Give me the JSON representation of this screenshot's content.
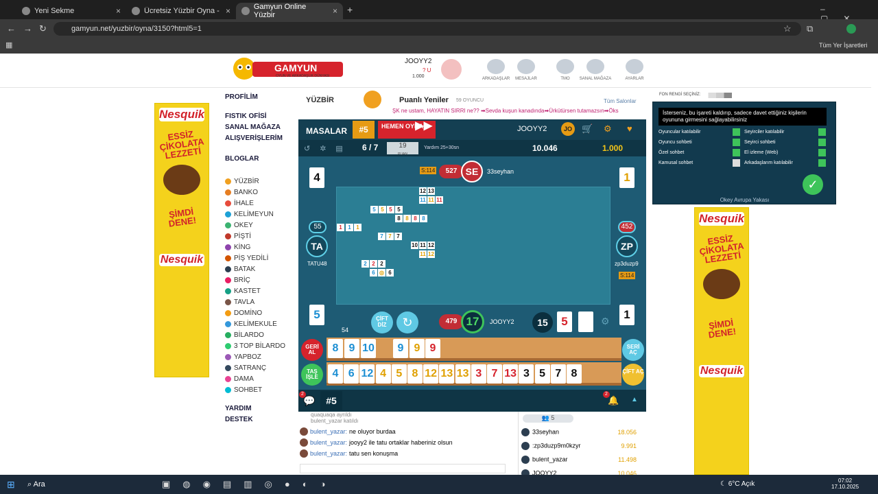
{
  "browser": {
    "tabs": [
      "Yeni Sekme",
      "Ücretsiz Yüzbir Oyna - Salon Li",
      "Gamyun Online Yüzbir"
    ],
    "url": "gamyun.net/yuzbir/oyna/3150?html5=1",
    "bookmarks_label": "Tüm Yer İşaretleri"
  },
  "site": {
    "logo": "GAMYUN",
    "logo_sub": "OYUN VE ARKADAŞLIK DÜNYASI",
    "user": "JOOYY2",
    "user_stat1": "? U",
    "user_stat2": "1.000",
    "nav": [
      "ARKADAŞLAR",
      "MESAJLAR",
      "TMO",
      "SANAL MAĞAZA",
      "AYARLAR"
    ]
  },
  "menu": {
    "items": [
      "PROFİLİM",
      "FISTIK OFİSİ",
      "SANAL MAĞAZA",
      "ALIŞVERİŞLERİM",
      "BLOGLAR"
    ],
    "games": [
      "YÜZBİR",
      "BANKO",
      "İHALE",
      "KELİMEYUN",
      "OKEY",
      "PİŞTİ",
      "KİNG",
      "PİŞ YEDİLİ",
      "BATAK",
      "BRİÇ",
      "KASTET",
      "TAVLA",
      "DOMİNO",
      "KELİMEKULE",
      "BİLARDO",
      "3 TOP BİLARDO",
      "YAPBOZ",
      "SATRANÇ",
      "DAMA",
      "SOHBET"
    ],
    "bottom": [
      "YARDIM",
      "DESTEK"
    ]
  },
  "room": {
    "game": "YÜZBİR",
    "category": "Puanlı Yeniler",
    "players": "59 OYUNCU",
    "all_rooms": "Tüm Salonlar",
    "ticker": "ŞK ne ustam, HAYATIN SIRRI ne?? ➡Sevda kuşun kanadında➡Ürkütürsen tutamazsın➡Öks"
  },
  "game": {
    "masalar": "MASALAR",
    "table_no": "#5",
    "play_now": "HEMEN OYNA!",
    "player_name": "JOOYY2",
    "player_badge": "JO",
    "round": "6 / 7",
    "points": "19",
    "points_label": "PUAN",
    "help": "Yardım 25+30sn",
    "chips": "10.046",
    "gold": "1.000",
    "top": {
      "score": "527",
      "badge": "SE",
      "name": "33seyhan",
      "s": "S:114",
      "card": "4",
      "card_r": "1"
    },
    "left": {
      "score": "55",
      "badge": "TA",
      "name": "TATU48",
      "card": "5"
    },
    "right": {
      "score": "452",
      "badge": "ZP",
      "name": "zp3duzp9",
      "s": "S:114",
      "card": "1"
    },
    "me": {
      "score": "479",
      "num": "17",
      "name": "JOOYY2",
      "cift": "ÇİFT DİZ",
      "count": "54",
      "deck": "15",
      "open": "5"
    },
    "btns": {
      "geri": "GERİ AL",
      "tas": "TAŞ İŞLE",
      "seri": "SERİ AÇ",
      "cift": "ÇİFT AÇ"
    },
    "rack1": [
      {
        "v": "8",
        "c": "bl"
      },
      {
        "v": "9",
        "c": "bl"
      },
      {
        "v": "10",
        "c": "bl"
      },
      {
        "v": "",
        "c": ""
      },
      {
        "v": "9",
        "c": "bl"
      },
      {
        "v": "9",
        "c": "yl"
      },
      {
        "v": "9",
        "c": "rd"
      }
    ],
    "rack2": [
      {
        "v": "4",
        "c": "bl"
      },
      {
        "v": "6",
        "c": "bl"
      },
      {
        "v": "12",
        "c": "bl"
      },
      {
        "v": "4",
        "c": "yl"
      },
      {
        "v": "5",
        "c": "yl"
      },
      {
        "v": "8",
        "c": "yl"
      },
      {
        "v": "12",
        "c": "yl"
      },
      {
        "v": "13",
        "c": "yl"
      },
      {
        "v": "13",
        "c": "yl"
      },
      {
        "v": "3",
        "c": "rd"
      },
      {
        "v": "7",
        "c": "rd"
      },
      {
        "v": "13",
        "c": "rd"
      },
      {
        "v": "3",
        "c": "bk"
      },
      {
        "v": "5",
        "c": "bk"
      },
      {
        "v": "7",
        "c": "bk"
      },
      {
        "v": "8",
        "c": "bk"
      }
    ],
    "chat_tag": "#5",
    "badge2": "2"
  },
  "chat": {
    "sys": [
      "quaquaqa ayrıldı",
      "bulent_yazar katıldı"
    ],
    "msgs": [
      {
        "u": "bulent_yazar",
        "t": "ne oluyor burdaa"
      },
      {
        "u": "bulent_yazar",
        "t": "jooyy2 ile tatu ortaklar haberiniz olsun"
      },
      {
        "u": "bulent_yazar",
        "t": "tatu sen konuşma"
      }
    ]
  },
  "users": {
    "count": "5",
    "list": [
      {
        "n": "33seyhan",
        "p": "18.056"
      },
      {
        "n": ":zp3duzp9m0kzyr",
        "p": "9.991"
      },
      {
        "n": "bulent_yazar",
        "p": "11.498"
      },
      {
        "n": "JOOYY2",
        "p": "10.046"
      }
    ]
  },
  "panel": {
    "font_label": "FON RENGİ SEÇİNİZ:",
    "tip": "İsterseniz, bu işareti kaldırıp, sadece davet ettiğiniz kişilerin oyununa girmesini sağlayabilirsiniz",
    "opts": [
      "Oyuncular katılabilir",
      "Seyirciler katılabilir",
      "Oyuncu sohbeti",
      "Seyirci sohbeti",
      "Özel sohbet",
      "El izleme (Web)",
      "Kamusal sohbet",
      "Arkadaşlarım katılabilir"
    ],
    "footer": "Okey Avrupa Yakası"
  },
  "ad": {
    "brand": "Nesquik",
    "slogan": "ESSİZ ÇİKOLATA LEZZETİ",
    "cta": "ŞİMDİ DENE!"
  },
  "taskbar": {
    "search": "Ara",
    "weather": "6°C Açık",
    "time": "07:02",
    "date": "17.10.2025"
  }
}
